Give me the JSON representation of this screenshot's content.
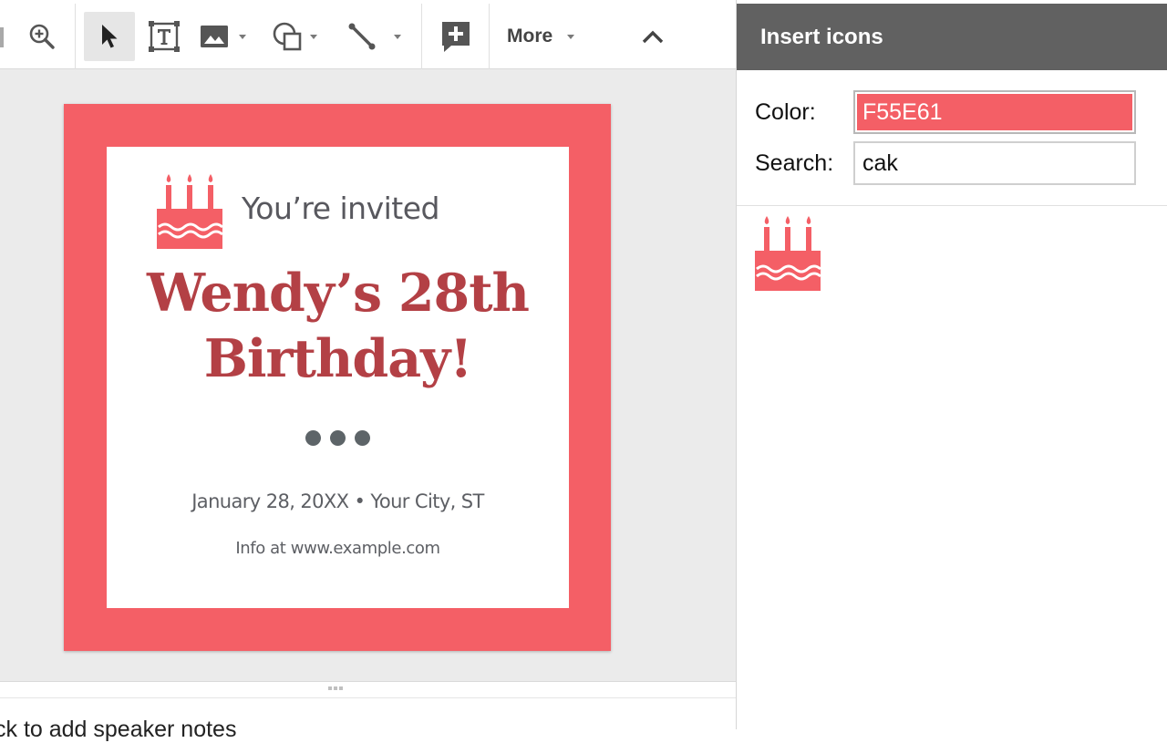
{
  "toolbar": {
    "items": [
      {
        "name": "zoom",
        "icon": "zoom-in-icon"
      },
      {
        "name": "select",
        "icon": "cursor-arrow-icon",
        "active": true
      },
      {
        "name": "text-box",
        "icon": "text-box-icon"
      },
      {
        "name": "image",
        "icon": "image-icon",
        "has_dropdown": true
      },
      {
        "name": "shape",
        "icon": "shape-icon",
        "has_dropdown": true
      },
      {
        "name": "line",
        "icon": "line-icon",
        "has_dropdown": true
      },
      {
        "name": "comment",
        "icon": "add-comment-icon"
      },
      {
        "name": "more",
        "label": "More",
        "has_dropdown": true
      },
      {
        "name": "collapse",
        "icon": "chevron-up-icon"
      }
    ],
    "more_label": "More"
  },
  "slide": {
    "background_color": "#F45F66",
    "invite_text": "You’re invited",
    "title_line1": "Wendy’s 28th",
    "title_line2": "Birthday!",
    "date_location": "January 28, 20XX • Your City, ST",
    "info": "Info at www.example.com",
    "title_color": "#B34045",
    "icon": "birthday-cake-icon"
  },
  "notes": {
    "text": "ck to add speaker notes"
  },
  "panel": {
    "title": "Insert icons",
    "color_label": "Color:",
    "color_value": "F55E61",
    "search_label": "Search:",
    "search_value": "cak",
    "results": [
      {
        "icon": "birthday-cake-icon",
        "color": "#F45F66"
      }
    ]
  }
}
